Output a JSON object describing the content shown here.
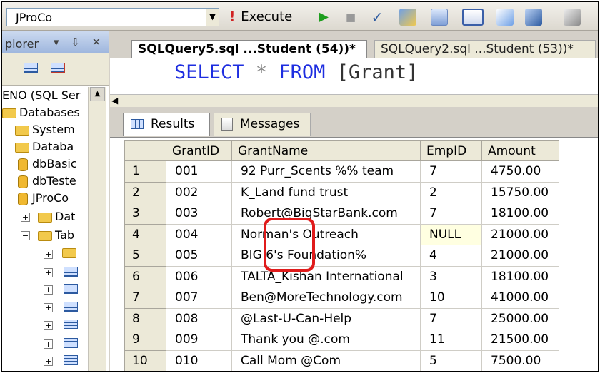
{
  "toolbar": {
    "database": "JProCo",
    "execute_label": "Execute",
    "execute_icon": "!"
  },
  "explorer": {
    "title": "plorer",
    "pin_controls": "▾ ⇩ ✕",
    "server": "ENO (SQL Ser",
    "items": [
      "Databases",
      "System",
      "Databa",
      "dbBasic",
      "dbTeste",
      "JProCo",
      "Dat",
      "Tab"
    ]
  },
  "tabs": {
    "active": "SQLQuery5.sql ...Student (54))*",
    "other": "SQLQuery2.sql ...Student (53))*"
  },
  "query": {
    "keyword1": "SELECT",
    "star": "*",
    "keyword2": "FROM",
    "object": "[Grant]"
  },
  "results_tabs": {
    "results": "Results",
    "messages": "Messages"
  },
  "grid": {
    "columns": [
      "GrantID",
      "GrantName",
      "EmpID",
      "Amount"
    ],
    "rows": [
      {
        "n": "1",
        "id": "001",
        "name": "92 Purr_Scents %% team",
        "emp": "7",
        "amount": "4750.00"
      },
      {
        "n": "2",
        "id": "002",
        "name": "K_Land fund trust",
        "emp": "2",
        "amount": "15750.00"
      },
      {
        "n": "3",
        "id": "003",
        "name": "Robert@BigStarBank.com",
        "emp": "7",
        "amount": "18100.00"
      },
      {
        "n": "4",
        "id": "004",
        "name": "Norman's Outreach",
        "emp": "NULL",
        "amount": "21000.00"
      },
      {
        "n": "5",
        "id": "005",
        "name": "BIG 6's Foundation%",
        "emp": "4",
        "amount": "21000.00"
      },
      {
        "n": "6",
        "id": "006",
        "name": "TALTA_Kishan International",
        "emp": "3",
        "amount": "18100.00"
      },
      {
        "n": "7",
        "id": "007",
        "name": "Ben@MoreTechnology.com",
        "emp": "10",
        "amount": "41000.00"
      },
      {
        "n": "8",
        "id": "008",
        "name": "@Last-U-Can-Help",
        "emp": "7",
        "amount": "25000.00"
      },
      {
        "n": "9",
        "id": "009",
        "name": "Thank you @.com",
        "emp": "11",
        "amount": "21500.00"
      },
      {
        "n": "10",
        "id": "010",
        "name": "Call Mom @Com",
        "emp": "5",
        "amount": "7500.00"
      }
    ]
  },
  "colors": {
    "keyword": "#1e2ee0",
    "highlight": "#e01b1b",
    "null_cell": "#ffffe1"
  }
}
